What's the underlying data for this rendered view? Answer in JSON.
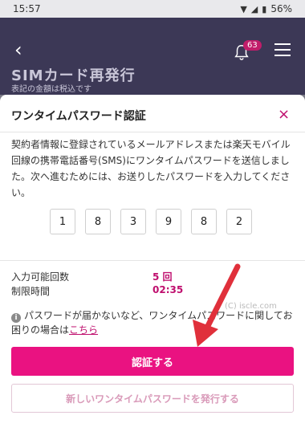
{
  "status_bar": {
    "time": "15:57",
    "battery": "56%"
  },
  "header": {
    "notification_count": "63",
    "page_title": "SIMカード再発行",
    "sub_note": "表記の金額は税込です"
  },
  "modal": {
    "title": "ワンタイムパスワード認証",
    "close_label": "×",
    "description": "契約者情報に登録されているメールアドレスまたは楽天モバイル回線の携帯電話番号(SMS)にワンタイムパスワードを送信しました。次へ進むためには、お送りしたパスワードを入力してください。",
    "otp_digits": [
      "1",
      "8",
      "3",
      "9",
      "8",
      "2"
    ],
    "attempts_label": "入力可能回数",
    "attempts_value": "5 回",
    "time_limit_label": "制限時間",
    "time_limit_value": "02:35",
    "notice_text": "パスワードが届かないなど、ワンタイムパスワードに関してお困りの場合は",
    "notice_link": "こちら",
    "watermark": "(C) iscle.com",
    "primary_button": "認証する",
    "secondary_button": "新しいワンタイムパスワードを発行する"
  },
  "colors": {
    "accent": "#ea1281",
    "header_bg": "#3c3856",
    "arrow": "#e0303b"
  }
}
